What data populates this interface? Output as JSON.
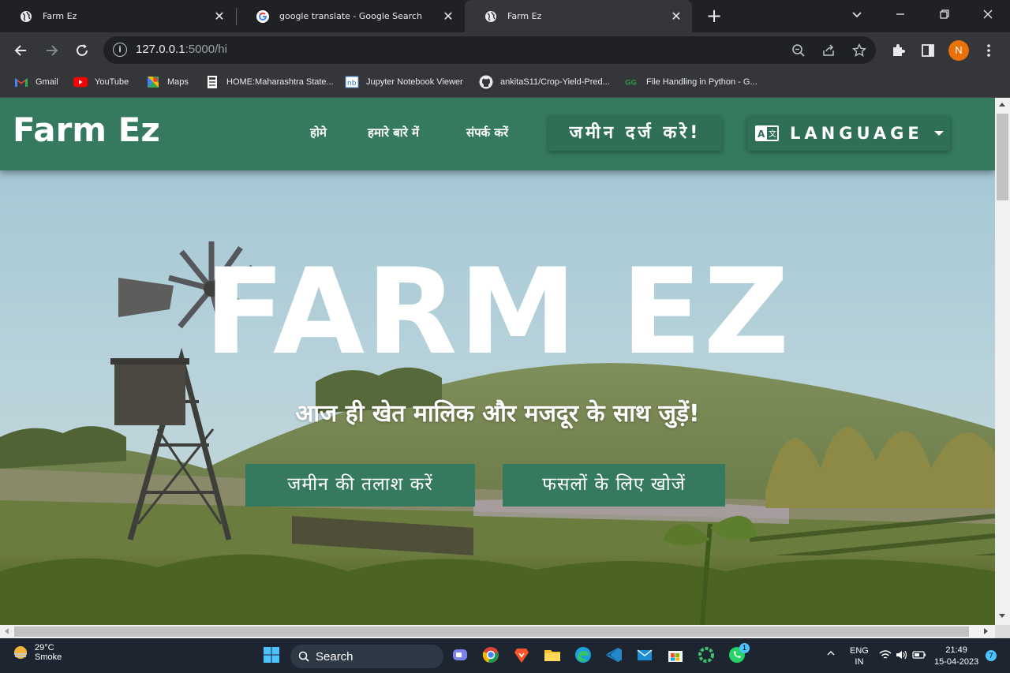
{
  "browser": {
    "tabs": [
      {
        "title": "Farm Ez",
        "favicon": "globe-icon",
        "active": false
      },
      {
        "title": "google translate - Google Search",
        "favicon": "google-icon",
        "active": false
      },
      {
        "title": "Farm Ez",
        "favicon": "globe-icon",
        "active": true
      }
    ],
    "close_glyph": "✕",
    "new_tab_glyph": "+",
    "address": {
      "host": "127.0.0.1",
      "path": ":5000/hi"
    },
    "profile_initial": "N",
    "bookmarks": [
      {
        "label": "Gmail",
        "icon": "gmail-icon"
      },
      {
        "label": "YouTube",
        "icon": "youtube-icon"
      },
      {
        "label": "Maps",
        "icon": "maps-icon"
      },
      {
        "label": "HOME:Maharashtra State...",
        "icon": "document-icon"
      },
      {
        "label": "Jupyter Notebook Viewer",
        "icon": "jupyter-icon"
      },
      {
        "label": "ankitaS11/Crop-Yield-Pred...",
        "icon": "github-icon"
      },
      {
        "label": "File Handling in Python - G...",
        "icon": "gfg-icon"
      }
    ]
  },
  "site": {
    "brand": "Farm Ez",
    "nav": {
      "home": "होमे",
      "about": "हमारे बारे में",
      "contact": "संपर्क करें",
      "register_land": "जमीन दर्ज करे!",
      "language": "LANGUAGE"
    },
    "hero": {
      "title": "FARM EZ",
      "subtitle": "आज ही खेत मालिक और मजदूर के साथ जुड़ें!",
      "buttons": {
        "find_land": "जमीन की तलाश करें",
        "find_crops": "फसलों के लिए खोजें"
      }
    },
    "colors": {
      "nav_green": "#357a5e",
      "button_green": "#357a5e"
    }
  },
  "taskbar": {
    "weather": {
      "temp": "29°C",
      "condition": "Smoke"
    },
    "search_label": "Search",
    "language": {
      "line1": "ENG",
      "line2": "IN"
    },
    "clock": {
      "time": "21:49",
      "date": "15-04-2023"
    },
    "notifications": "7",
    "whatsapp_badge": "1"
  }
}
